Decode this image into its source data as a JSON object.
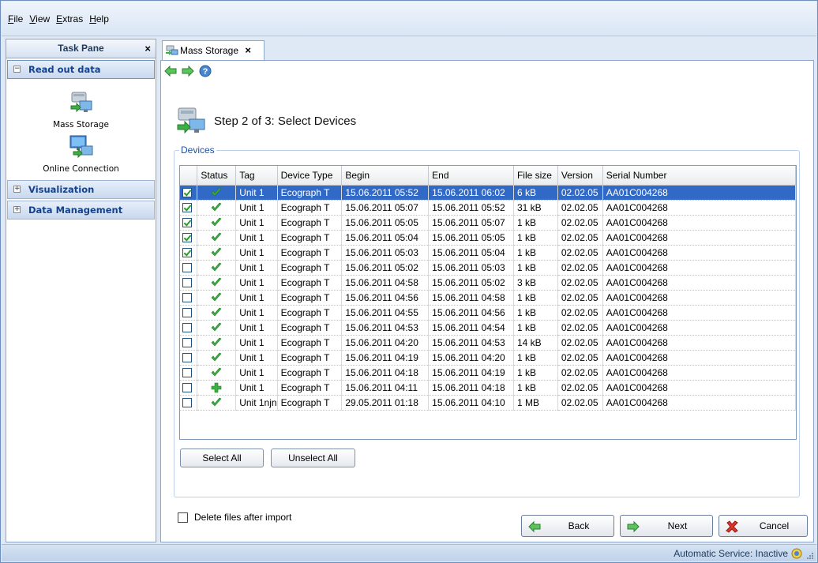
{
  "menu": {
    "items": [
      {
        "mnemonic": "F",
        "rest": "ile"
      },
      {
        "mnemonic": "V",
        "rest": "iew"
      },
      {
        "mnemonic": "E",
        "rest": "xtras"
      },
      {
        "mnemonic": "H",
        "rest": "elp"
      }
    ]
  },
  "taskpane": {
    "title": "Task Pane",
    "close": "×",
    "sections": {
      "read_out_data": {
        "label": "Read out data",
        "toggle": "−"
      },
      "visualization": {
        "label": "Visualization",
        "toggle": "+"
      },
      "data_management": {
        "label": "Data Management",
        "toggle": "+"
      }
    },
    "items": {
      "mass_storage": "Mass Storage",
      "online_connection": "Online Connection"
    }
  },
  "tab": {
    "label": "Mass Storage",
    "close": "×"
  },
  "step_title": "Step 2 of 3: Select Devices",
  "devices_group": "Devices",
  "table": {
    "headers": [
      "",
      "Status",
      "Tag",
      "Device Type",
      "Begin",
      "End",
      "File size",
      "Version",
      "Serial Number"
    ],
    "rows": [
      {
        "checked": true,
        "status": "ok",
        "tag": "Unit 1",
        "type": "Ecograph T",
        "begin": "15.06.2011 05:52",
        "end": "15.06.2011 06:02",
        "size": "6 kB",
        "version": "02.02.05",
        "serial": "AA01C004268",
        "selected": true
      },
      {
        "checked": true,
        "status": "ok",
        "tag": "Unit 1",
        "type": "Ecograph T",
        "begin": "15.06.2011 05:07",
        "end": "15.06.2011 05:52",
        "size": "31 kB",
        "version": "02.02.05",
        "serial": "AA01C004268"
      },
      {
        "checked": true,
        "status": "ok",
        "tag": "Unit 1",
        "type": "Ecograph T",
        "begin": "15.06.2011 05:05",
        "end": "15.06.2011 05:07",
        "size": "1 kB",
        "version": "02.02.05",
        "serial": "AA01C004268"
      },
      {
        "checked": true,
        "status": "ok",
        "tag": "Unit 1",
        "type": "Ecograph T",
        "begin": "15.06.2011 05:04",
        "end": "15.06.2011 05:05",
        "size": "1 kB",
        "version": "02.02.05",
        "serial": "AA01C004268"
      },
      {
        "checked": true,
        "status": "ok",
        "tag": "Unit 1",
        "type": "Ecograph T",
        "begin": "15.06.2011 05:03",
        "end": "15.06.2011 05:04",
        "size": "1 kB",
        "version": "02.02.05",
        "serial": "AA01C004268"
      },
      {
        "checked": false,
        "status": "ok",
        "tag": "Unit 1",
        "type": "Ecograph T",
        "begin": "15.06.2011 05:02",
        "end": "15.06.2011 05:03",
        "size": "1 kB",
        "version": "02.02.05",
        "serial": "AA01C004268"
      },
      {
        "checked": false,
        "status": "ok",
        "tag": "Unit 1",
        "type": "Ecograph T",
        "begin": "15.06.2011 04:58",
        "end": "15.06.2011 05:02",
        "size": "3 kB",
        "version": "02.02.05",
        "serial": "AA01C004268"
      },
      {
        "checked": false,
        "status": "ok",
        "tag": "Unit 1",
        "type": "Ecograph T",
        "begin": "15.06.2011 04:56",
        "end": "15.06.2011 04:58",
        "size": "1 kB",
        "version": "02.02.05",
        "serial": "AA01C004268"
      },
      {
        "checked": false,
        "status": "ok",
        "tag": "Unit 1",
        "type": "Ecograph T",
        "begin": "15.06.2011 04:55",
        "end": "15.06.2011 04:56",
        "size": "1 kB",
        "version": "02.02.05",
        "serial": "AA01C004268"
      },
      {
        "checked": false,
        "status": "ok",
        "tag": "Unit 1",
        "type": "Ecograph T",
        "begin": "15.06.2011 04:53",
        "end": "15.06.2011 04:54",
        "size": "1 kB",
        "version": "02.02.05",
        "serial": "AA01C004268"
      },
      {
        "checked": false,
        "status": "ok",
        "tag": "Unit 1",
        "type": "Ecograph T",
        "begin": "15.06.2011 04:20",
        "end": "15.06.2011 04:53",
        "size": "14 kB",
        "version": "02.02.05",
        "serial": "AA01C004268"
      },
      {
        "checked": false,
        "status": "ok",
        "tag": "Unit 1",
        "type": "Ecograph T",
        "begin": "15.06.2011 04:19",
        "end": "15.06.2011 04:20",
        "size": "1 kB",
        "version": "02.02.05",
        "serial": "AA01C004268"
      },
      {
        "checked": false,
        "status": "ok",
        "tag": "Unit 1",
        "type": "Ecograph T",
        "begin": "15.06.2011 04:18",
        "end": "15.06.2011 04:19",
        "size": "1 kB",
        "version": "02.02.05",
        "serial": "AA01C004268"
      },
      {
        "checked": false,
        "status": "new",
        "tag": "Unit 1",
        "type": "Ecograph T",
        "begin": "15.06.2011 04:11",
        "end": "15.06.2011 04:18",
        "size": "1 kB",
        "version": "02.02.05",
        "serial": "AA01C004268"
      },
      {
        "checked": false,
        "status": "ok",
        "tag": "Unit 1njn",
        "type": "Ecograph T",
        "begin": "29.05.2011 01:18",
        "end": "15.06.2011 04:10",
        "size": "1 MB",
        "version": "02.02.05",
        "serial": "AA01C004268"
      }
    ]
  },
  "buttons": {
    "select_all": "Select All",
    "unselect_all": "Unselect All",
    "back": "Back",
    "next": "Next",
    "cancel": "Cancel"
  },
  "delete_files_label": "Delete files after import",
  "status_bar": {
    "text": "Automatic Service: Inactive"
  },
  "icons": {
    "status_ok": "check-icon",
    "status_new": "plus-icon",
    "back": "arrow-left-icon",
    "next": "arrow-right-icon",
    "cancel": "cancel-x-icon"
  },
  "colors": {
    "selection": "#3169c6",
    "ok_green": "#3cb043",
    "accent_blue": "#15428b"
  }
}
